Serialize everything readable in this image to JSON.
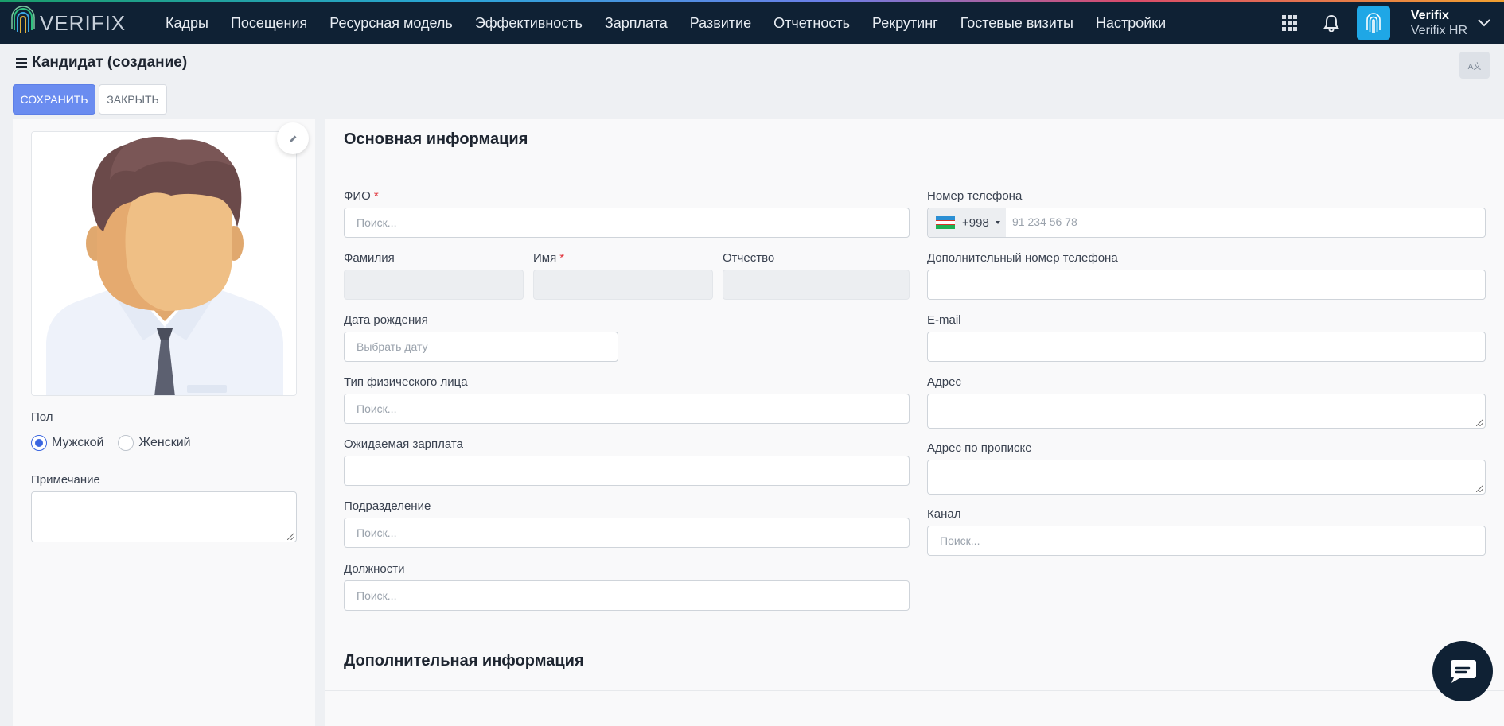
{
  "app": {
    "logo_text": "VERIFIX",
    "nav": [
      "Кадры",
      "Посещения",
      "Ресурсная модель",
      "Эффективность",
      "Зарплата",
      "Развитие",
      "Отчетность",
      "Рекрутинг",
      "Гостевые визиты",
      "Настройки"
    ],
    "user_name": "Verifix",
    "user_org": "Verifix HR",
    "lang_button": "A文"
  },
  "page": {
    "title": "Кандидат (создание)",
    "save_label": "СОХРАНИТЬ",
    "close_label": "ЗАКРЫТЬ"
  },
  "left": {
    "gender_label": "Пол",
    "gender_options": [
      "Мужской",
      "Женский"
    ],
    "gender_selected": "Мужской",
    "note_label": "Примечание"
  },
  "main": {
    "section_basic": "Основная информация",
    "section_extra": "Дополнительная информация",
    "fio_label": "ФИО",
    "fio_placeholder": "Поиск...",
    "last_name_label": "Фамилия",
    "first_name_label": "Имя",
    "middle_name_label": "Отчество",
    "birth_label": "Дата рождения",
    "birth_placeholder": "Выбрать дату",
    "person_type_label": "Тип физического лица",
    "person_type_placeholder": "Поиск...",
    "salary_label": "Ожидаемая зарплата",
    "division_label": "Подразделение",
    "division_placeholder": "Поиск...",
    "positions_label": "Должности",
    "positions_placeholder": "Поиск...",
    "phone_label": "Номер телефона",
    "phone_code": "+998",
    "phone_placeholder": "91 234 56 78",
    "extra_phone_label": "Дополнительный номер телефона",
    "email_label": "E-mail",
    "address_label": "Адрес",
    "reg_address_label": "Адрес по прописке",
    "channel_label": "Канал",
    "channel_placeholder": "Поиск...",
    "required_mark": "*"
  },
  "colors": {
    "topbar": "#0f2134",
    "primary": "#6a8cf0",
    "radio_active": "#3b66e0",
    "required": "#e0323a"
  }
}
